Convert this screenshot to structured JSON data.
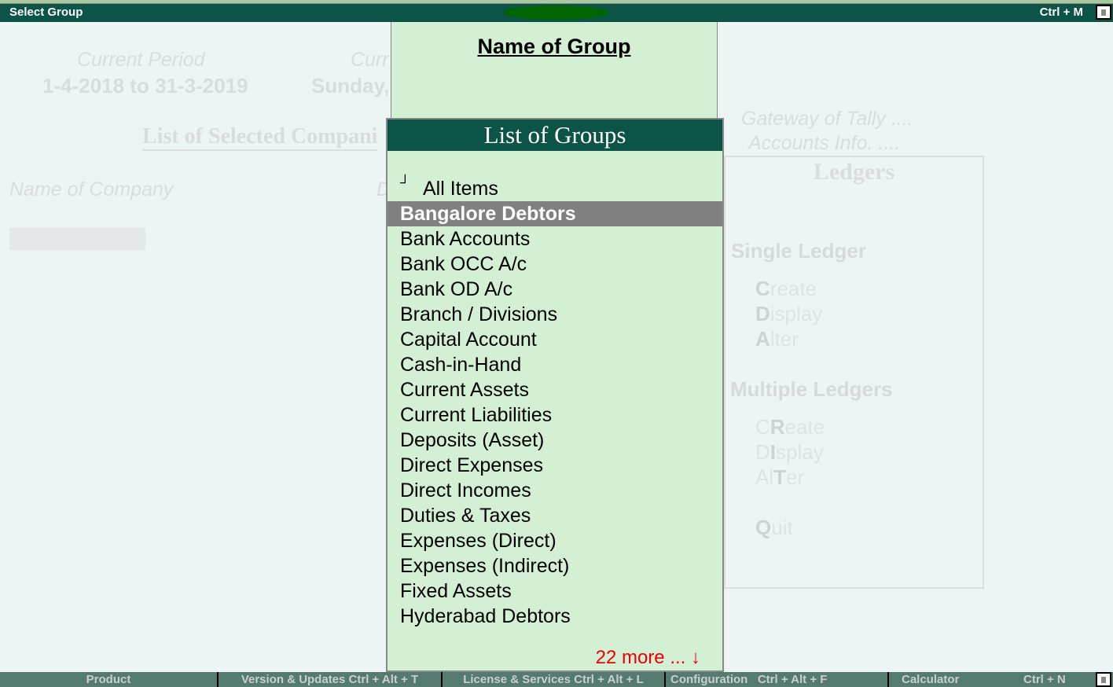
{
  "titlebar": {
    "title": "Select Group",
    "shortcut": "Ctrl + M"
  },
  "background": {
    "current_period_label": "Current Period",
    "current_period_value": "1-4-2018 to 31-3-2019",
    "current_date_label": "Curr",
    "current_date_value": "Sunday,",
    "list_title": "List of Selected Compani",
    "name_col": "Name of Company",
    "date_col": "D",
    "breadcrumb1": "Gateway of Tally ....",
    "breadcrumb2": "Accounts Info. ....",
    "ledgers_title": "Ledgers",
    "single_header": "Single Ledger",
    "multiple_header": "Multiple Ledgers",
    "menu": [
      {
        "pre": "",
        "key": "C",
        "post": "reate"
      },
      {
        "pre": "",
        "key": "D",
        "post": "isplay"
      },
      {
        "pre": "",
        "key": "A",
        "post": "lter"
      },
      {
        "pre": "C",
        "key": "R",
        "post": "eate"
      },
      {
        "pre": "D",
        "key": "I",
        "post": "splay"
      },
      {
        "pre": "Al",
        "key": "T",
        "post": "er"
      },
      {
        "pre": "",
        "key": "Q",
        "post": "uit"
      }
    ]
  },
  "name_of_group": {
    "title": "Name of Group"
  },
  "list_of_groups": {
    "title": "List of Groups",
    "end_marker": "┘",
    "items": [
      "All Items",
      "Bangalore Debtors",
      "Bank Accounts",
      "Bank OCC A/c",
      "Bank OD A/c",
      "Branch / Divisions",
      "Capital Account",
      "Cash-in-Hand",
      "Current Assets",
      "Current Liabilities",
      "Deposits (Asset)",
      "Direct Expenses",
      "Direct Incomes",
      "Duties & Taxes",
      "Expenses (Direct)",
      "Expenses (Indirect)",
      "Fixed Assets",
      "Hyderabad Debtors"
    ],
    "selected": "Bangalore Debtors",
    "more": "22 more ... ↓"
  },
  "footer": {
    "items": [
      "Product",
      "Version & Updates Ctrl + Alt + T",
      "License & Services Ctrl + Alt + L",
      "Configuration   Ctrl + Alt + F",
      "Calculator",
      "Ctrl + N"
    ]
  },
  "colors": {
    "header": "#0d5448",
    "panel": "#d4f0d4",
    "selection": "#808080",
    "more": "#ee0000"
  }
}
